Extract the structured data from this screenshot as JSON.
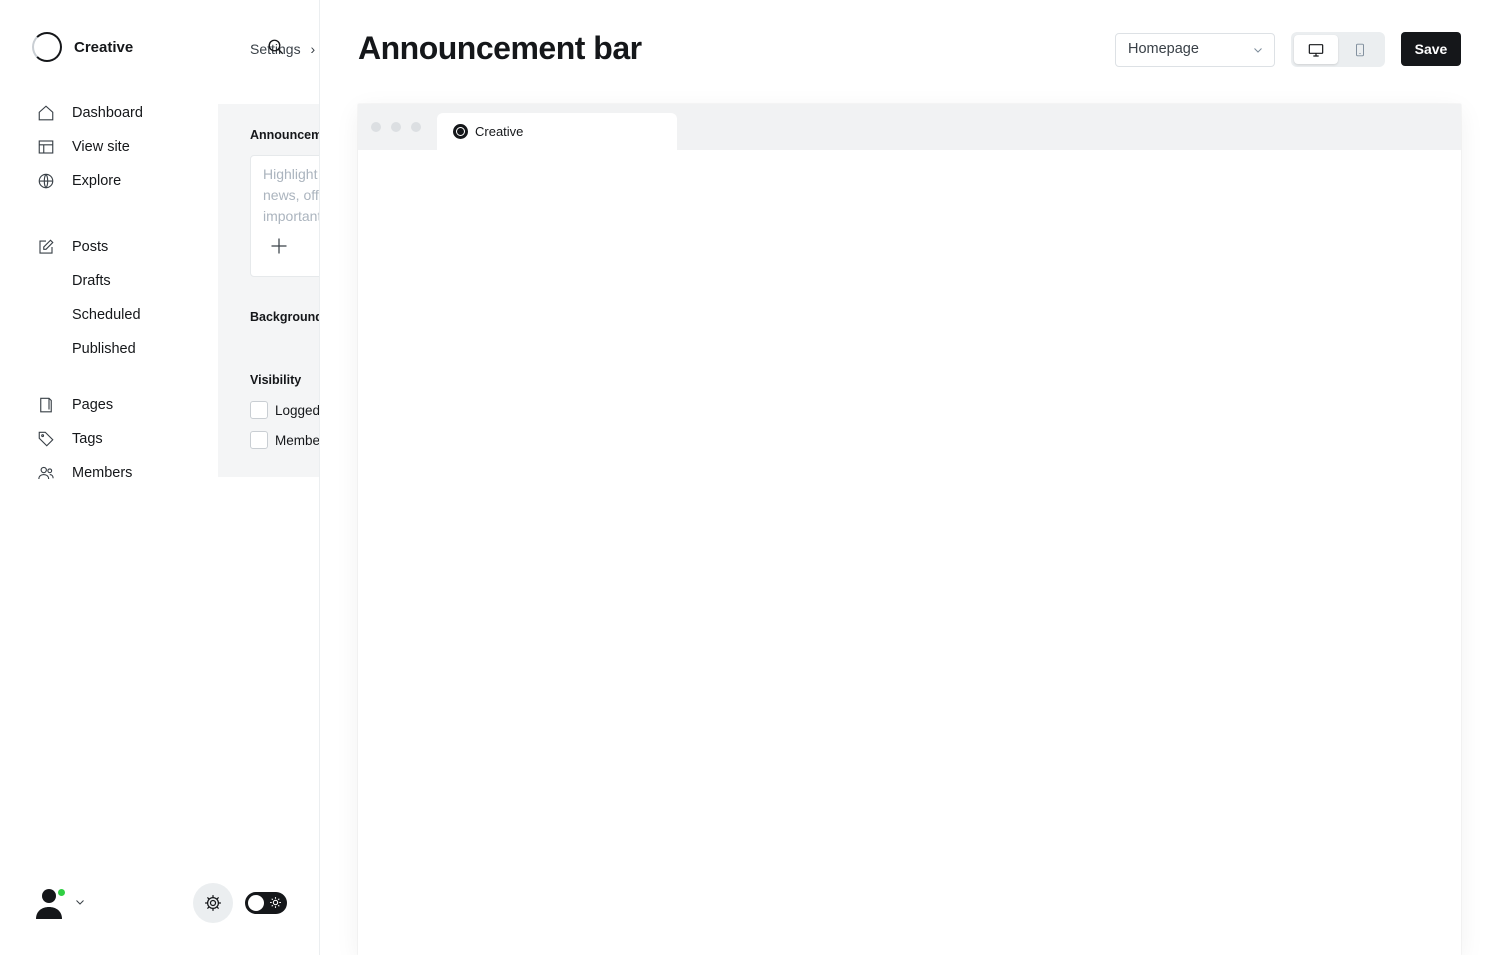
{
  "sidebar": {
    "brand": "Creative",
    "nav": [
      {
        "label": "Dashboard",
        "icon": "home-icon"
      },
      {
        "label": "View site",
        "icon": "layout-icon"
      },
      {
        "label": "Explore",
        "icon": "globe-icon"
      }
    ],
    "posts": {
      "label": "Posts",
      "icon": "edit-icon",
      "sub": [
        "Drafts",
        "Scheduled",
        "Published"
      ]
    },
    "nav2": [
      {
        "label": "Pages",
        "icon": "page-icon"
      },
      {
        "label": "Tags",
        "icon": "tag-icon"
      },
      {
        "label": "Members",
        "icon": "members-icon"
      }
    ],
    "status_color": "#30cf43"
  },
  "settings": {
    "breadcrumb": "Settings",
    "announcement_label": "Announcement",
    "announcement_placeholder": "Highlight breaking news, offers or important updates",
    "background_label": "Background",
    "visibility_label": "Visibility",
    "visibility_options": [
      "Logged out visitors",
      "Members"
    ]
  },
  "header": {
    "title": "Announcement bar",
    "page_select": "Homepage",
    "save_label": "Save"
  },
  "preview": {
    "tab_title": "Creative"
  },
  "colors": {
    "accent": "#15171a",
    "panel_bg": "#f4f5f6"
  }
}
